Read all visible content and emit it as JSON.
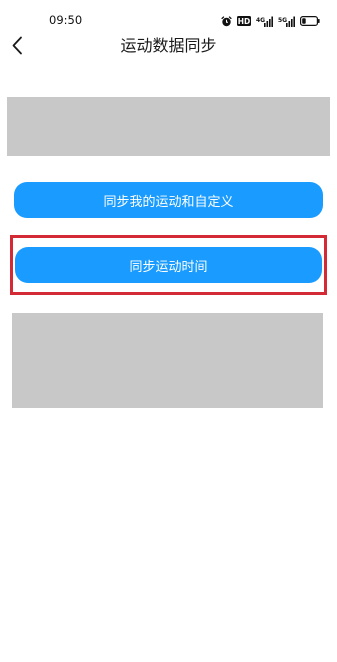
{
  "status_bar": {
    "time": "09:50",
    "icons": [
      "alarm-icon",
      "hd-icon",
      "signal-4g-icon",
      "signal-5g-icon",
      "battery-icon"
    ],
    "hd_label": "HD",
    "signal_4g_label": "4G",
    "signal_5g_label": "5G"
  },
  "header": {
    "title": "运动数据同步",
    "back_icon": "chevron-left-icon"
  },
  "buttons": {
    "sync_custom_label": "同步我的运动和自定义",
    "sync_time_label": "同步运动时间"
  },
  "colors": {
    "button_blue": "#1a9bff",
    "highlight_red": "#d42a35",
    "placeholder_gray": "#c8c8c8"
  }
}
